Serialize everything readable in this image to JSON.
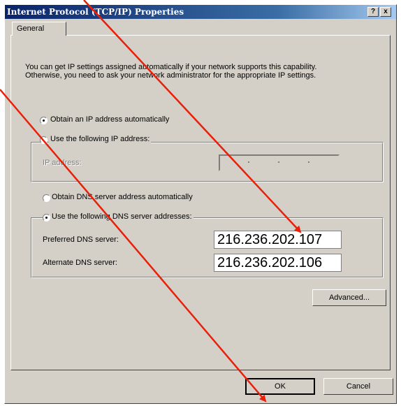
{
  "window": {
    "title": "Internet Protocol (TCP/IP) Properties",
    "help_label": "?",
    "close_label": "x"
  },
  "tabs": [
    {
      "label": "General"
    }
  ],
  "intro_text": "You can get IP settings assigned automatically if your network supports this capability. Otherwise, you need to ask your network administrator for the appropriate IP settings.",
  "ip_settings": {
    "auto_label": "Obtain an IP address automatically",
    "manual_label": "Use the following IP address:",
    "selected": "auto",
    "ip_address_label": "IP address:",
    "ip_address_value": ""
  },
  "dns_settings": {
    "auto_label": "Obtain DNS server address automatically",
    "manual_label": "Use the following DNS server addresses:",
    "selected": "manual",
    "preferred_label": "Preferred DNS server:",
    "preferred_value": "216.236.202.107",
    "alternate_label": "Alternate DNS server:",
    "alternate_value": "216.236.202.106"
  },
  "buttons": {
    "advanced_label": "Advanced...",
    "ok_label": "OK",
    "cancel_label": "Cancel"
  },
  "colors": {
    "dialog_bg": "#d4d0c8",
    "title_bar": "#0a246a",
    "annotation_arrow": "#e8200a"
  }
}
